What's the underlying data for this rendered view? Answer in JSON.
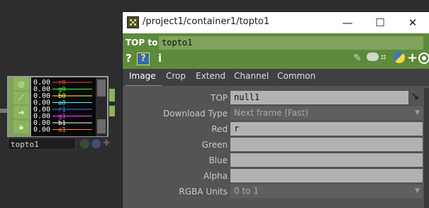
{
  "window": {
    "title": "/project1/container1/topto1",
    "minimize": "—",
    "maximize": "☐",
    "close": "✕"
  },
  "header": {
    "op_label": "TOP to",
    "op_name": "topto1",
    "help_q": "?",
    "help_q2": "?",
    "info": "i"
  },
  "tabs": [
    {
      "label": "Image"
    },
    {
      "label": "Crop"
    },
    {
      "label": "Extend"
    },
    {
      "label": "Channel"
    },
    {
      "label": "Common"
    }
  ],
  "params": {
    "top": {
      "label": "TOP",
      "value": "null1"
    },
    "download_type": {
      "label": "Download Type",
      "value": "Next frame (Fast)"
    },
    "red": {
      "label": "Red",
      "value": "r"
    },
    "green": {
      "label": "Green",
      "value": ""
    },
    "blue": {
      "label": "Blue",
      "value": ""
    },
    "alpha": {
      "label": "Alpha",
      "value": ""
    },
    "rgba_units": {
      "label": "RGBA Units",
      "value": "0 to 1"
    }
  },
  "node": {
    "name": "topto1",
    "preview_rows": [
      {
        "value": "0.00",
        "name": "r0",
        "color": "#ff4040"
      },
      {
        "value": "0.00",
        "name": "g0",
        "color": "#40ff40"
      },
      {
        "value": "0.00",
        "name": "b0",
        "color": "#ffff40"
      },
      {
        "value": "0.00",
        "name": "a0",
        "color": "#40ffff"
      },
      {
        "value": "0.00",
        "name": "r1",
        "color": "#4080ff"
      },
      {
        "value": "0.00",
        "name": "g1",
        "color": "#ff40ff"
      },
      {
        "value": "0.00",
        "name": "b1",
        "color": "#ffffff"
      },
      {
        "value": "0.00",
        "name": "a1",
        "color": "#ff8040"
      }
    ]
  },
  "colors": {
    "accent_green": "#5d8a3b",
    "field_gray": "#b2b2b2"
  }
}
